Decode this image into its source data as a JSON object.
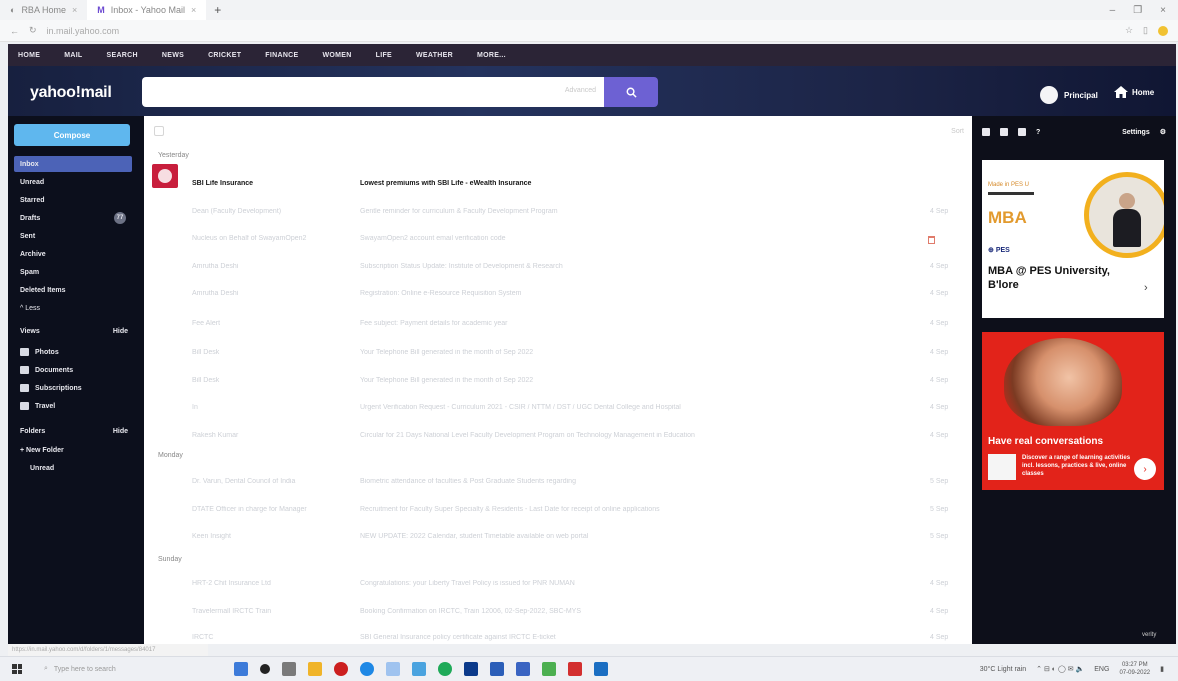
{
  "browser": {
    "tabs": [
      {
        "title": "RBA Home"
      },
      {
        "title": "Inbox - Yahoo Mail"
      }
    ],
    "url": "in.mail.yahoo.com",
    "status_url": "https://in.mail.yahoo.com/d/folders/1/messages/84017"
  },
  "yahoo_nav": [
    "HOME",
    "MAIL",
    "SEARCH",
    "NEWS",
    "CRICKET",
    "FINANCE",
    "WOMEN",
    "LIFE",
    "WEATHER",
    "MORE..."
  ],
  "header": {
    "logo": "yahoo!mail",
    "search_placeholder": "",
    "search_hint": "Advanced",
    "user_name": "Principal",
    "home_label": "Home"
  },
  "sidebar": {
    "compose": "Compose",
    "folders": [
      {
        "label": "Inbox",
        "active": true
      },
      {
        "label": "Unread"
      },
      {
        "label": "Starred"
      },
      {
        "label": "Drafts",
        "count": "77"
      },
      {
        "label": "Sent"
      },
      {
        "label": "Archive"
      },
      {
        "label": "Spam"
      },
      {
        "label": "Deleted Items"
      },
      {
        "label": "^ Less"
      }
    ],
    "views_label": "Views",
    "views_hide": "Hide",
    "views": [
      {
        "label": "Photos"
      },
      {
        "label": "Documents"
      },
      {
        "label": "Subscriptions"
      },
      {
        "label": "Travel"
      }
    ],
    "folders_label": "Folders",
    "folders_hide": "Hide",
    "custom_folders": [
      {
        "label": "+ New Folder"
      },
      {
        "label": "Unread"
      }
    ]
  },
  "list": {
    "select_all": "",
    "sort_label": "Sort",
    "groups": [
      {
        "label": "Yesterday",
        "messages": [
          {
            "sender": "SBI Life Insurance",
            "subject": "Lowest premiums with SBI Life - eWealth Insurance",
            "time": "",
            "unread": true
          },
          {
            "sender": "Dean (Faculty Development)",
            "subject": "Gentle reminder for curriculum & Faculty Development Program",
            "time": "4 Sep"
          },
          {
            "sender": "Nucleus on Behalf of SwayamOpen2",
            "subject": "SwayamOpen2 account email verification code",
            "time": "4 Sep"
          },
          {
            "sender": "Amrutha Deshi",
            "subject": "Subscription Status Update: Institute of Development & Research",
            "time": "4 Sep"
          },
          {
            "sender": "Amrutha Deshi",
            "subject": "Registration: Online e-Resource Requisition System",
            "time": "4 Sep"
          },
          {
            "sender": "Fee Alert",
            "subject": "Fee subject: Payment details for academic year",
            "time": "4 Sep"
          },
          {
            "sender": "Bill Desk",
            "subject": "Your Telephone Bill generated in the month of Sep 2022",
            "time": "4 Sep"
          },
          {
            "sender": "Bill Desk",
            "subject": "Your Telephone Bill generated in the month of Sep 2022",
            "time": "4 Sep"
          },
          {
            "sender": "In",
            "subject": "Urgent Verification Request - Curriculum 2021 - CSIR / NTTM / DST / UGC Dental College and Hospital",
            "time": "4 Sep"
          },
          {
            "sender": "Rakesh Kumar",
            "subject": "Circular for 21 Days National Level Faculty Development Program on Technology Management in Education",
            "time": "4 Sep"
          }
        ]
      },
      {
        "label": "Monday",
        "messages": [
          {
            "sender": "Dr. Varun, Dental Council of India",
            "subject": "Biometric attendance of faculties & Post Graduate Students regarding",
            "time": "5 Sep"
          },
          {
            "sender": "DTATE Officer in charge for Manager",
            "subject": "Recruitment for Faculty Super Specialty & Residents - Last Date for receipt of online applications",
            "time": "5 Sep"
          },
          {
            "sender": "Keen Insight",
            "subject": "NEW UPDATE: 2022 Calendar, student Timetable available on web portal",
            "time": "5 Sep"
          }
        ]
      },
      {
        "label": "Sunday",
        "messages": [
          {
            "sender": "HRT-2 Chit Insurance Ltd",
            "subject": "Congratulations: your Liberty Travel Policy is issued for PNR NUMAN",
            "time": "4 Sep"
          },
          {
            "sender": "Travelermall IRCTC Train",
            "subject": "Booking Confirmation on IRCTC, Train 12006, 02-Sep-2022, SBC-MYS",
            "time": "4 Sep"
          },
          {
            "sender": "IRCTC",
            "subject": "SBI General Insurance policy certificate against IRCTC E-ticket",
            "time": "4 Sep"
          }
        ]
      }
    ]
  },
  "right_panel": {
    "settings_label": "Settings",
    "ad1": {
      "tag": "Made in PES U",
      "mba": "MBA",
      "brand": "PES",
      "headline": "MBA @ PES University, B'lore"
    },
    "ad2": {
      "title": "Have real conversations",
      "body": "Discover a range of learning activities incl. lessons, practices & live, online classes"
    },
    "bottom_label": "verity"
  },
  "taskbar": {
    "search_placeholder": "Type here to search",
    "weather": "30°C Light rain",
    "lang": "ENG",
    "time": "03:27 PM",
    "date": "07-09-2022"
  },
  "colors": {
    "compose": "#5fb7ee",
    "search_button": "#6d61d3",
    "active_folder": "#4c63b7",
    "ad2": "#e2231a"
  }
}
